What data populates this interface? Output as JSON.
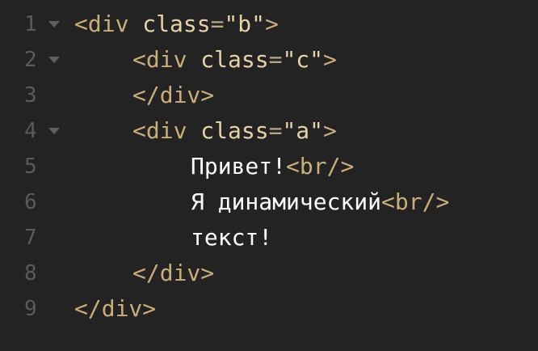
{
  "editor": {
    "lines": [
      {
        "number": "1",
        "foldable": true,
        "tokens": [
          "<div",
          " ",
          "class",
          "=",
          "\"b\"",
          ">"
        ]
      },
      {
        "number": "2",
        "foldable": true,
        "tokens": [
          "<div",
          " ",
          "class",
          "=",
          "\"c\"",
          ">"
        ]
      },
      {
        "number": "3",
        "foldable": false,
        "tokens": [
          "</div>"
        ]
      },
      {
        "number": "4",
        "foldable": true,
        "tokens": [
          "<div",
          " ",
          "class",
          "=",
          "\"a\"",
          ">"
        ]
      },
      {
        "number": "5",
        "foldable": false,
        "tokens": [
          "Привет!",
          "<br/>"
        ]
      },
      {
        "number": "6",
        "foldable": false,
        "tokens": [
          "Я динамический",
          "<br/>"
        ]
      },
      {
        "number": "7",
        "foldable": false,
        "tokens": [
          "текст!"
        ]
      },
      {
        "number": "8",
        "foldable": false,
        "tokens": [
          "</div>"
        ]
      },
      {
        "number": "9",
        "foldable": false,
        "tokens": [
          "</div>"
        ]
      }
    ]
  },
  "colors": {
    "background": "#232323",
    "line_number": "#5a5a5a",
    "tag": "#c9ae7a",
    "attribute": "#e5d3a6",
    "text": "#ffffff"
  },
  "icons": {
    "fold": "chevron-down-icon"
  }
}
